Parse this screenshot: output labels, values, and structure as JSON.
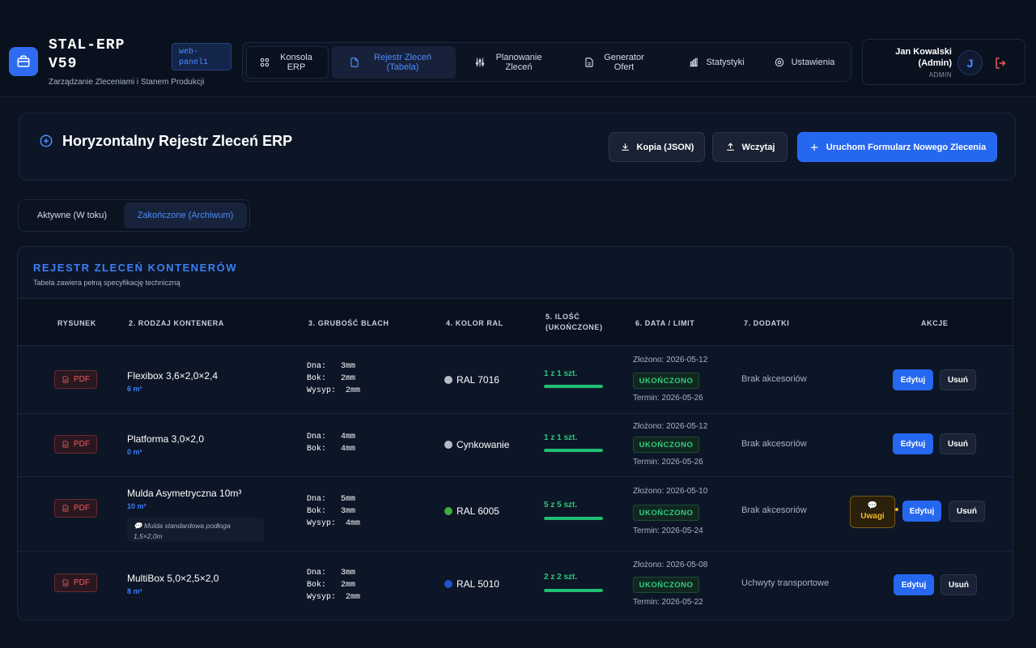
{
  "app": {
    "title": "STAL-ERP V59",
    "subtitle": "Zarządzanie Zleceniami i Stanem Produkcji",
    "badge": "web-panel1"
  },
  "nav": {
    "items": [
      {
        "label": "Konsola ERP",
        "icon": "grid-icon"
      },
      {
        "label": "Rejestr Zleceń (Tabela)",
        "icon": "document-icon"
      },
      {
        "label": "Planowanie Zleceń",
        "icon": "sliders-icon"
      },
      {
        "label": "Generator Ofert",
        "icon": "file-text-icon"
      },
      {
        "label": "Statystyki",
        "icon": "bar-chart-icon"
      },
      {
        "label": "Ustawienia",
        "icon": "gear-icon"
      }
    ]
  },
  "user": {
    "name": "Jan Kowalski (Admin)",
    "role": "ADMIN",
    "initial": "J"
  },
  "page": {
    "title": "Horyzontalny Rejestr Zleceń ERP",
    "btn_backup": "Kopia (JSON)",
    "btn_load": "Wczytaj",
    "btn_new": "Uruchom Formularz Nowego Zlecenia"
  },
  "tabs": {
    "active_work": "Aktywne (W toku)",
    "archive": "Zakończone (Archiwum)"
  },
  "table": {
    "title": "REJESTR ZLECEŃ KONTENERÓW",
    "subtitle": "Tabela zawiera pełną specyfikację techniczną",
    "headers": {
      "drawing": "RYSUNEK",
      "type": "2. RODZAJ KONTENERA",
      "thickness": "3. GRUBOŚĆ BLACH",
      "ral": "4. KOLOR RAL",
      "qty_line1": "5. ILOŚĆ",
      "qty_line2": "(UKOŃCZONE)",
      "date": "6. DATA / LIMIT",
      "extras": "7. DODATKI",
      "actions": "AKCJE"
    },
    "pdf_label": "PDF",
    "edit_label": "Edytuj",
    "delete_label": "Usuń",
    "notes_label": "Uwagi",
    "rows": [
      {
        "name": "Flexibox 3,6×2,0×2,4",
        "volume": "6 m³",
        "thickness": "Dna:   3mm\nBok:   2mm\nWysyp:  2mm",
        "ral": "RAL 7016",
        "ral_color": "#b7bcc4",
        "qty": "1 z 1 szt.",
        "progress": 1.0,
        "submitted": "Złożono: 2026-05-12",
        "status": "UKOŃCZONO",
        "deadline": "Termin: 2026-05-26",
        "extras": "Brak akcesoriów"
      },
      {
        "name": "Platforma 3,0×2,0",
        "volume": "0 m³",
        "thickness": "Dna:   4mm\nBok:   4mm",
        "ral": "Cynkowanie",
        "ral_color": "#b7bcc4",
        "qty": "1 z 1 szt.",
        "progress": 1.0,
        "submitted": "Złożono: 2026-05-12",
        "status": "UKOŃCZONO",
        "deadline": "Termin: 2026-05-26",
        "extras": "Brak akcesoriów"
      },
      {
        "name": "Mulda Asymetryczna 10m³",
        "volume": "10 m³",
        "note": "💬 Mulda standardowa podłoga 1,5×2,0m",
        "thickness": "Dna:   5mm\nBok:   3mm\nWysyp:  4mm",
        "ral": "RAL 6005",
        "ral_color": "#3fae3a",
        "qty": "5 z 5 szt.",
        "progress": 1.0,
        "submitted": "Złożono: 2026-05-10",
        "status": "UKOŃCZONO",
        "deadline": "Termin: 2026-05-24",
        "extras": "Brak akcesoriów"
      },
      {
        "name": "MultiBox 5,0×2,5×2,0",
        "volume": "8 m³",
        "thickness": "Dna:   3mm\nBok:   2mm\nWysyp:  2mm",
        "ral": "RAL 5010",
        "ral_color": "#1e56c9",
        "qty": "2 z 2 szt.",
        "progress": 1.0,
        "submitted": "Złożono: 2026-05-08",
        "status": "UKOŃCZONO",
        "deadline": "Termin: 2026-05-22",
        "extras": "Uchwyty transportowe"
      }
    ]
  }
}
